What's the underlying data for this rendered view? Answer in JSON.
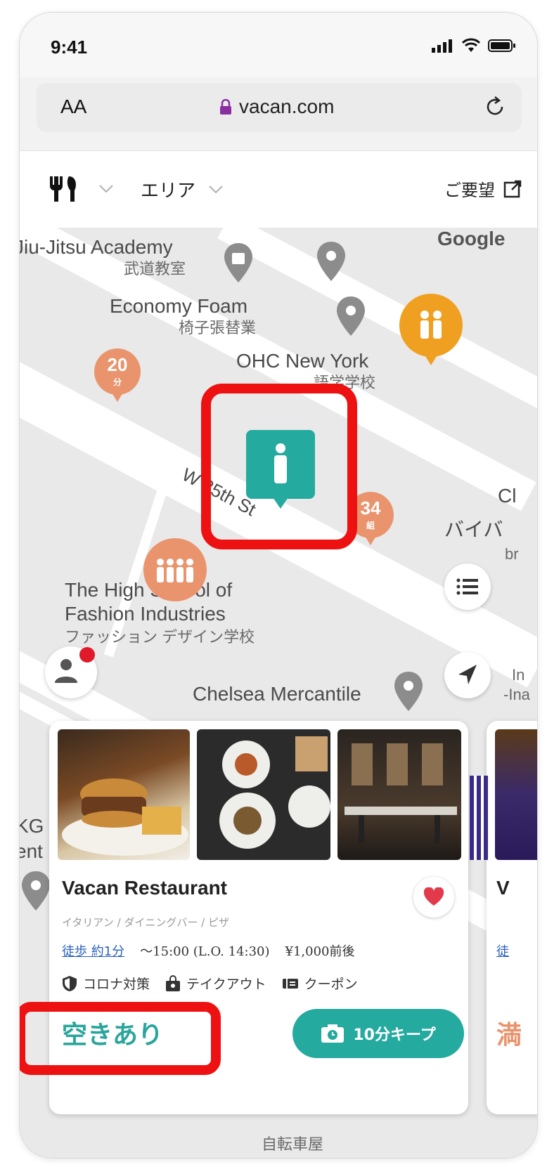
{
  "status_bar": {
    "time": "9:41"
  },
  "browser": {
    "text_size_label": "AA",
    "url": "vacan.com"
  },
  "nav": {
    "area_label": "エリア",
    "request_label": "ご要望"
  },
  "map": {
    "labels": {
      "jiu_jitsu": "Jiu-Jitsu Academy",
      "jiu_jitsu_sub": "武道教室",
      "economy_foam": "Economy Foam",
      "economy_foam_sub": "椅子張替業",
      "ohc": "OHC New York",
      "ohc_sub": "語学学校",
      "street": "W 25th St",
      "high_school": "The High School of",
      "fashion": "Fashion Industries",
      "fashion_sub": "ファッション デザイン学校",
      "chelsea": "Chelsea Mercantile",
      "google": "Google",
      "bybyb": "バイバ",
      "ch": "Cl",
      "br": "br",
      "inl": "In",
      "ina": "-Ina",
      "kg": "KG",
      "ent": "ent",
      "bicycle": "自転車屋"
    },
    "pins": {
      "twenty": "20",
      "twenty_unit": "分",
      "thirtyfour": "34",
      "thirtyfour_unit": "組"
    },
    "colors": {
      "teal": "#25aaa0",
      "salmon": "#e9946d",
      "amber": "#f0a020",
      "highlight": "#ee1111"
    }
  },
  "card": {
    "name": "Vacan Restaurant",
    "genre": "イタリアン / ダイニングバー / ピザ",
    "walk": "徒歩 約1分",
    "hours": "〜15:00 (L.O. 14:30)",
    "price": "¥1,000前後",
    "features": [
      "コロナ対策",
      "テイクアウト",
      "クーポン"
    ],
    "status": "空きあり",
    "keep_button": "10分キープ"
  },
  "card2": {
    "initial": "V",
    "walk_initial": "徒",
    "status_initial": "満"
  }
}
